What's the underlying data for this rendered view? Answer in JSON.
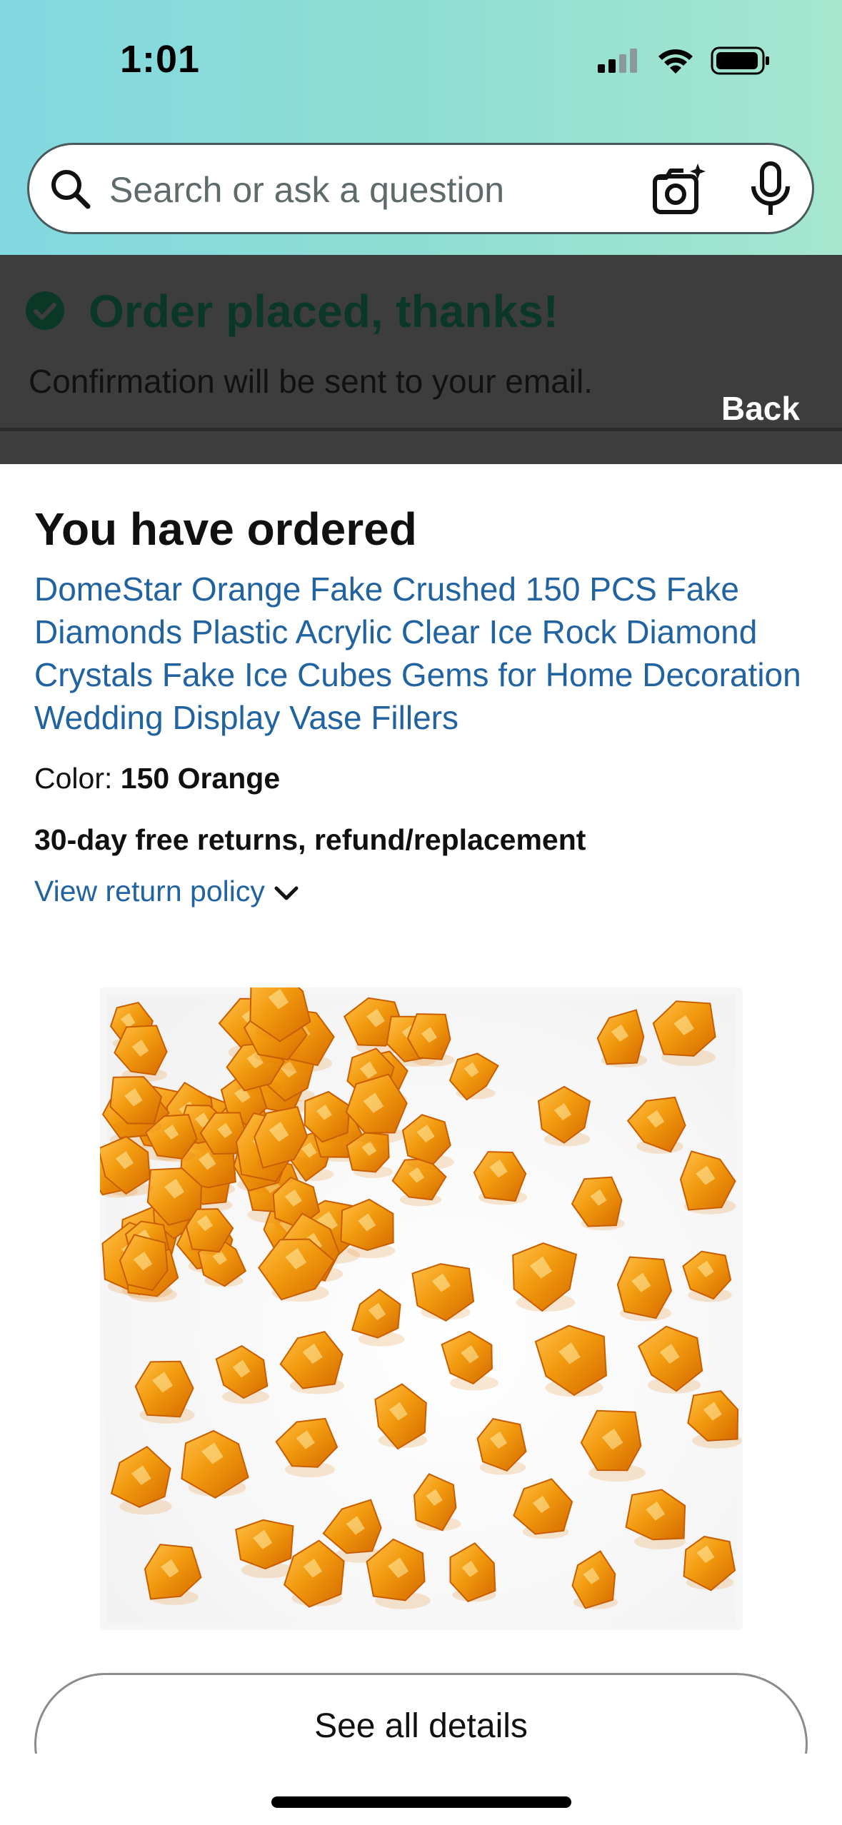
{
  "status_bar": {
    "time": "1:01"
  },
  "search": {
    "placeholder": "Search or ask a question"
  },
  "banner": {
    "title": "Order placed, thanks!",
    "subtitle": "Confirmation will be sent to your email.",
    "back_label": "Back"
  },
  "order": {
    "heading": "You have ordered",
    "product_title": "DomeStar Orange Fake Crushed 150 PCS Fake Diamonds Plastic Acrylic Clear Ice Rock Diamond Crystals Fake Ice Cubes Gems for Home Decoration Wedding Display Vase Fillers",
    "color_label": "Color:",
    "color_value": "150 Orange",
    "returns_text": "30-day free returns, refund/replacement",
    "return_policy_link": "View return policy"
  },
  "details_button": {
    "label": "See all details"
  },
  "colors": {
    "link_blue": "#2162a1",
    "success_green": "#0b3826",
    "header_gradient_start": "#82d8e0",
    "header_gradient_end": "#a6e6cf",
    "overlay": "#3d3d3d"
  },
  "icons": [
    "search-icon",
    "camera-icon",
    "mic-icon",
    "check-circle-icon",
    "chevron-down-icon",
    "signal-icon",
    "wifi-icon",
    "battery-icon"
  ]
}
